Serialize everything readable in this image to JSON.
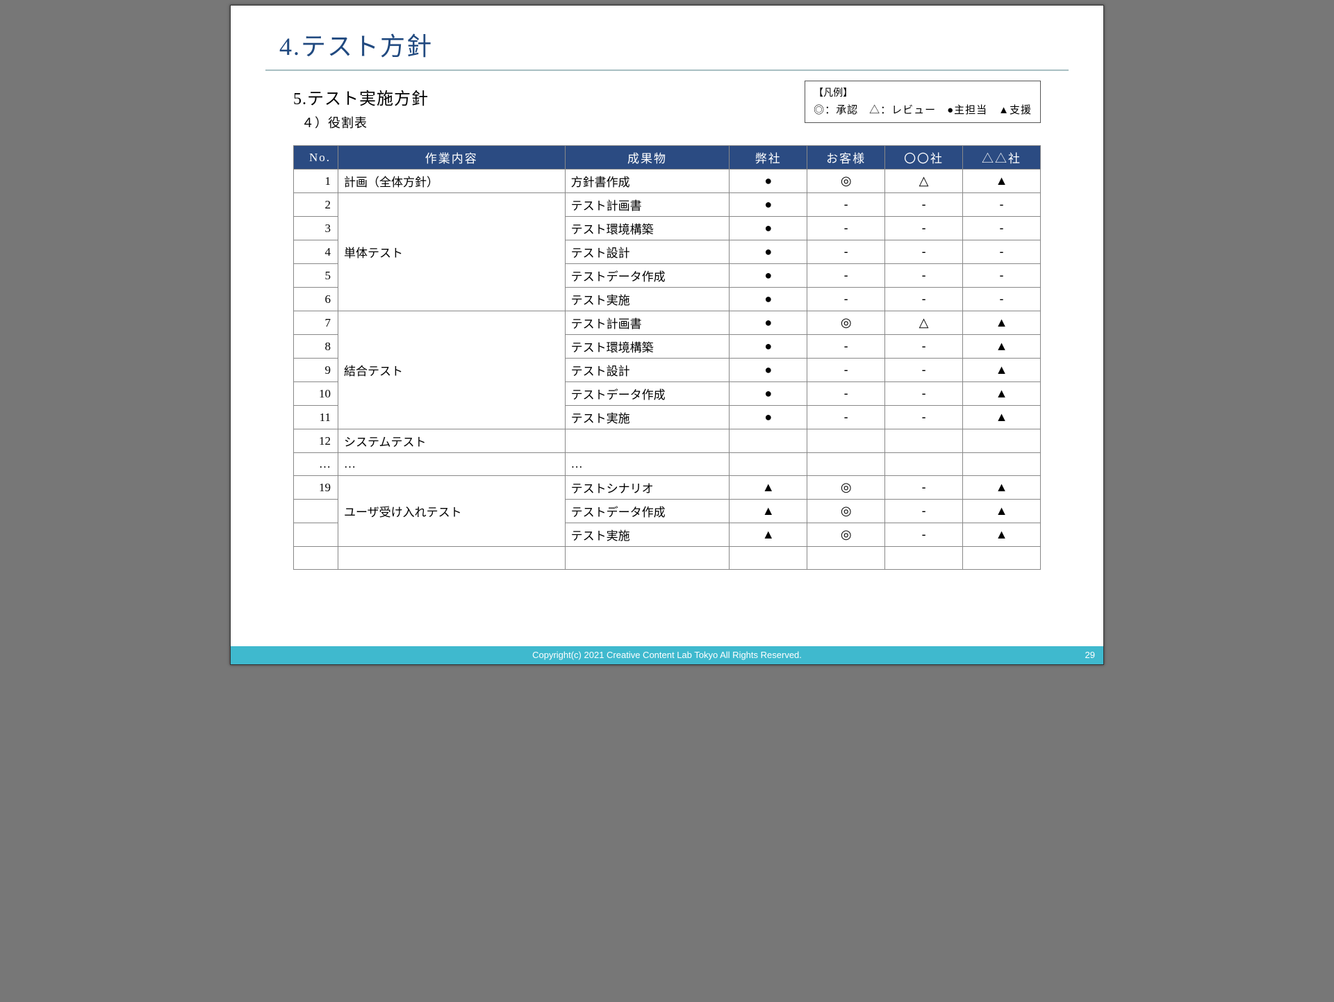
{
  "title": "4.テスト方針",
  "subtitle": "5.テスト実施方針",
  "subsub": "４）役割表",
  "legend": {
    "label": "【凡例】",
    "items": "◎：承認　△：レビュー　●主担当　▲支援"
  },
  "columns": {
    "no": "No.",
    "work": "作業内容",
    "deliv": "成果物",
    "c1": "弊社",
    "c2": "お客様",
    "c3": "〇〇社",
    "c4": "△△社"
  },
  "rows": [
    {
      "no": "1",
      "work": "計画（全体方針）",
      "deliv": "方針書作成",
      "c1": "●",
      "c2": "◎",
      "c3": "△",
      "c4": "▲"
    },
    {
      "no": "2",
      "work": "単体テスト",
      "deliv": "テスト計画書",
      "c1": "●",
      "c2": "-",
      "c3": "-",
      "c4": "-"
    },
    {
      "no": "3",
      "work": "",
      "deliv": "テスト環境構築",
      "c1": "●",
      "c2": "-",
      "c3": "-",
      "c4": "-"
    },
    {
      "no": "4",
      "work": "",
      "deliv": "テスト設計",
      "c1": "●",
      "c2": "-",
      "c3": "-",
      "c4": "-"
    },
    {
      "no": "5",
      "work": "",
      "deliv": "テストデータ作成",
      "c1": "●",
      "c2": "-",
      "c3": "-",
      "c4": "-"
    },
    {
      "no": "6",
      "work": "",
      "deliv": "テスト実施",
      "c1": "●",
      "c2": "-",
      "c3": "-",
      "c4": "-"
    },
    {
      "no": "7",
      "work": "結合テスト",
      "deliv": "テスト計画書",
      "c1": "●",
      "c2": "◎",
      "c3": "△",
      "c4": "▲"
    },
    {
      "no": "8",
      "work": "",
      "deliv": "テスト環境構築",
      "c1": "●",
      "c2": "-",
      "c3": "-",
      "c4": "▲"
    },
    {
      "no": "9",
      "work": "",
      "deliv": "テスト設計",
      "c1": "●",
      "c2": "-",
      "c3": "-",
      "c4": "▲"
    },
    {
      "no": "10",
      "work": "",
      "deliv": "テストデータ作成",
      "c1": "●",
      "c2": "-",
      "c3": "-",
      "c4": "▲"
    },
    {
      "no": "11",
      "work": "",
      "deliv": "テスト実施",
      "c1": "●",
      "c2": "-",
      "c3": "-",
      "c4": "▲"
    },
    {
      "no": "12",
      "work": "システムテスト",
      "deliv": "",
      "c1": "",
      "c2": "",
      "c3": "",
      "c4": ""
    },
    {
      "no": "…",
      "work": "…",
      "deliv": "…",
      "c1": "",
      "c2": "",
      "c3": "",
      "c4": ""
    },
    {
      "no": "19",
      "work": "ユーザ受け入れテスト",
      "deliv": "テストシナリオ",
      "c1": "▲",
      "c2": "◎",
      "c3": "-",
      "c4": "▲"
    },
    {
      "no": "",
      "work": "",
      "deliv": "テストデータ作成",
      "c1": "▲",
      "c2": "◎",
      "c3": "-",
      "c4": "▲"
    },
    {
      "no": "",
      "work": "",
      "deliv": "テスト実施",
      "c1": "▲",
      "c2": "◎",
      "c3": "-",
      "c4": "▲"
    },
    {
      "no": "",
      "work": "",
      "deliv": "",
      "c1": "",
      "c2": "",
      "c3": "",
      "c4": ""
    }
  ],
  "footer": {
    "copyright": "Copyright(c) 2021 Creative Content Lab Tokyo All Rights Reserved.",
    "page": "29"
  },
  "merges": {
    "work": [
      {
        "start": 1,
        "span": 5
      },
      {
        "start": 6,
        "span": 5
      },
      {
        "start": 13,
        "span": 3
      }
    ]
  }
}
